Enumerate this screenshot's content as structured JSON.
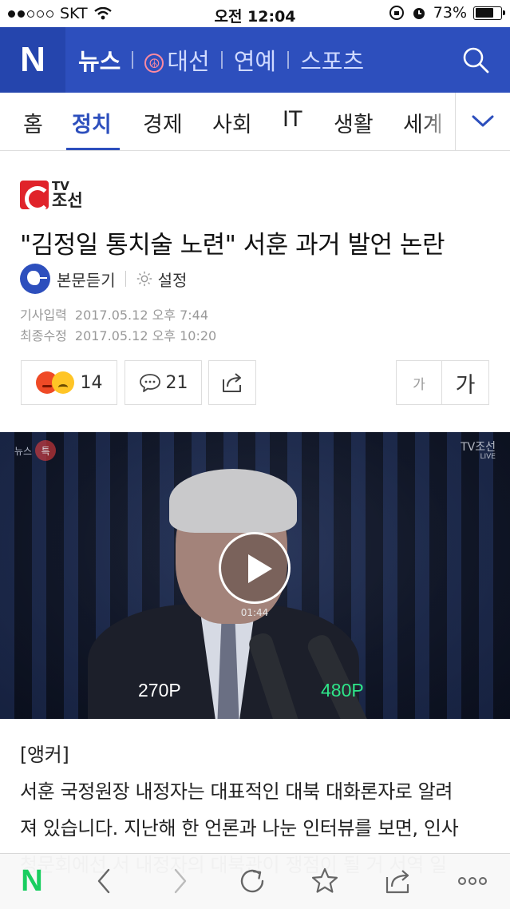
{
  "status_bar": {
    "carrier": "SKT",
    "time": "오전 12:04",
    "battery": "73%",
    "battery_level": 0.73
  },
  "header": {
    "logo": "N",
    "nav": [
      {
        "label": "뉴스",
        "active": true
      },
      {
        "label": "대선",
        "active": false
      },
      {
        "label": "연예",
        "active": false
      },
      {
        "label": "스포츠",
        "active": false
      }
    ],
    "search_icon": "search-icon",
    "brand_color": "#2d4fbd"
  },
  "tabs": {
    "items": [
      "홈",
      "정치",
      "경제",
      "사회",
      "IT",
      "생활",
      "세계"
    ],
    "active": "정치",
    "more_icon": "chevron-down-icon"
  },
  "article": {
    "press_tv": "TV",
    "press_name": "조선",
    "title": "\"김정일 통치술 노련\" 서훈 과거 발언 논란",
    "listen_label": "본문듣기",
    "settings_label": "설정",
    "published_label": "기사입력",
    "published": "2017.05.12 오후 7:44",
    "modified_label": "최종수정",
    "modified": "2017.05.12 오후 10:20",
    "reactions_count": "14",
    "comments_count": "21",
    "font_small": "가",
    "font_large": "가"
  },
  "video": {
    "badge": "뉴스",
    "badge_mark": "특",
    "brand": "TV조선",
    "brand_sub": "LIVE",
    "duration": "01:44",
    "quality_options": [
      "270P",
      "480P"
    ],
    "quality_selected": "480P"
  },
  "body": {
    "lines": [
      "[앵커]",
      "서훈 국정원장 내정자는 대표적인 대북 대화론자로 알려",
      "져 있습니다. 지난해 한 언론과 나눈 인터뷰를 보면, 인사",
      "청문회에선 서 내정자의 대북관이 쟁점이 될 거 서역 일"
    ]
  },
  "toolbar": {
    "home_logo": "N",
    "icons": [
      "back-icon",
      "forward-icon",
      "refresh-icon",
      "bookmark-icon",
      "share-icon",
      "more-icon"
    ]
  }
}
